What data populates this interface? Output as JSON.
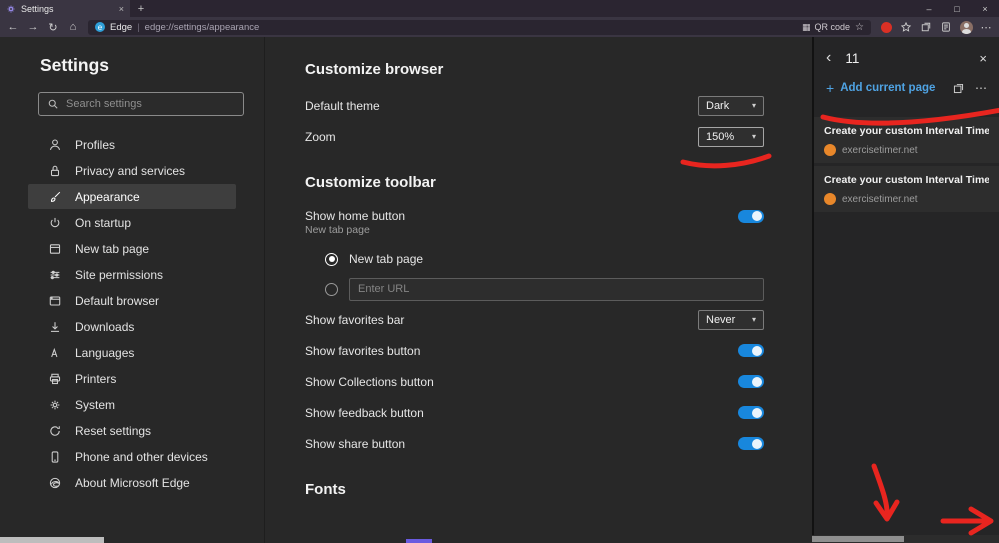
{
  "titlebar": {
    "tab_title": "Settings",
    "tab_close_glyph": "×",
    "new_tab_button": "+",
    "minimize": "–",
    "maximize": "□",
    "close": "×"
  },
  "toolbar": {
    "back": "←",
    "forward": "→",
    "refresh": "↻",
    "home": "⌂",
    "site_label": "Edge",
    "separator": "|",
    "url": "edge://settings/appearance",
    "qr_icon": "▦",
    "qr_label": "QR code",
    "favorite_star": "☆",
    "more_menu": "⋯"
  },
  "sidebar": {
    "title": "Settings",
    "search_placeholder": "Search settings",
    "items": [
      {
        "label": "Profiles"
      },
      {
        "label": "Privacy and services"
      },
      {
        "label": "Appearance"
      },
      {
        "label": "On startup"
      },
      {
        "label": "New tab page"
      },
      {
        "label": "Site permissions"
      },
      {
        "label": "Default browser"
      },
      {
        "label": "Downloads"
      },
      {
        "label": "Languages"
      },
      {
        "label": "Printers"
      },
      {
        "label": "System"
      },
      {
        "label": "Reset settings"
      },
      {
        "label": "Phone and other devices"
      },
      {
        "label": "About Microsoft Edge"
      }
    ]
  },
  "main": {
    "customize_browser_title": "Customize browser",
    "default_theme_label": "Default theme",
    "default_theme_value": "Dark",
    "zoom_label": "Zoom",
    "zoom_value": "150%",
    "chevron": "▾",
    "customize_toolbar_title": "Customize toolbar",
    "show_home_button_label": "Show home button",
    "show_home_button_caption": "New tab page",
    "home_radio_newtab_label": "New tab page",
    "home_url_placeholder": "Enter URL",
    "show_favorites_bar_label": "Show favorites bar",
    "show_favorites_bar_value": "Never",
    "toggle_rows": [
      {
        "label": "Show favorites button",
        "state": "on"
      },
      {
        "label": "Show Collections button",
        "state": "on"
      },
      {
        "label": "Show feedback button",
        "state": "on"
      },
      {
        "label": "Show share button",
        "state": "on"
      }
    ],
    "fonts_title": "Fonts"
  },
  "collections": {
    "back_glyph": "‹",
    "title": "11",
    "close_glyph": "×",
    "plus_glyph": "+",
    "add_current_page": "Add current page",
    "more_glyph": "⋯",
    "items": [
      {
        "title": "Create your custom Interval Timer - Exer",
        "domain": "exercisetimer.net"
      },
      {
        "title": "Create your custom Interval Timer - Exer",
        "domain": "exercisetimer.net"
      }
    ]
  },
  "colors": {
    "toggle_blue": "#1887dd",
    "link_blue": "#4fa3e3",
    "annotation_red": "#e8251f",
    "favicon_orange": "#e8872a"
  }
}
